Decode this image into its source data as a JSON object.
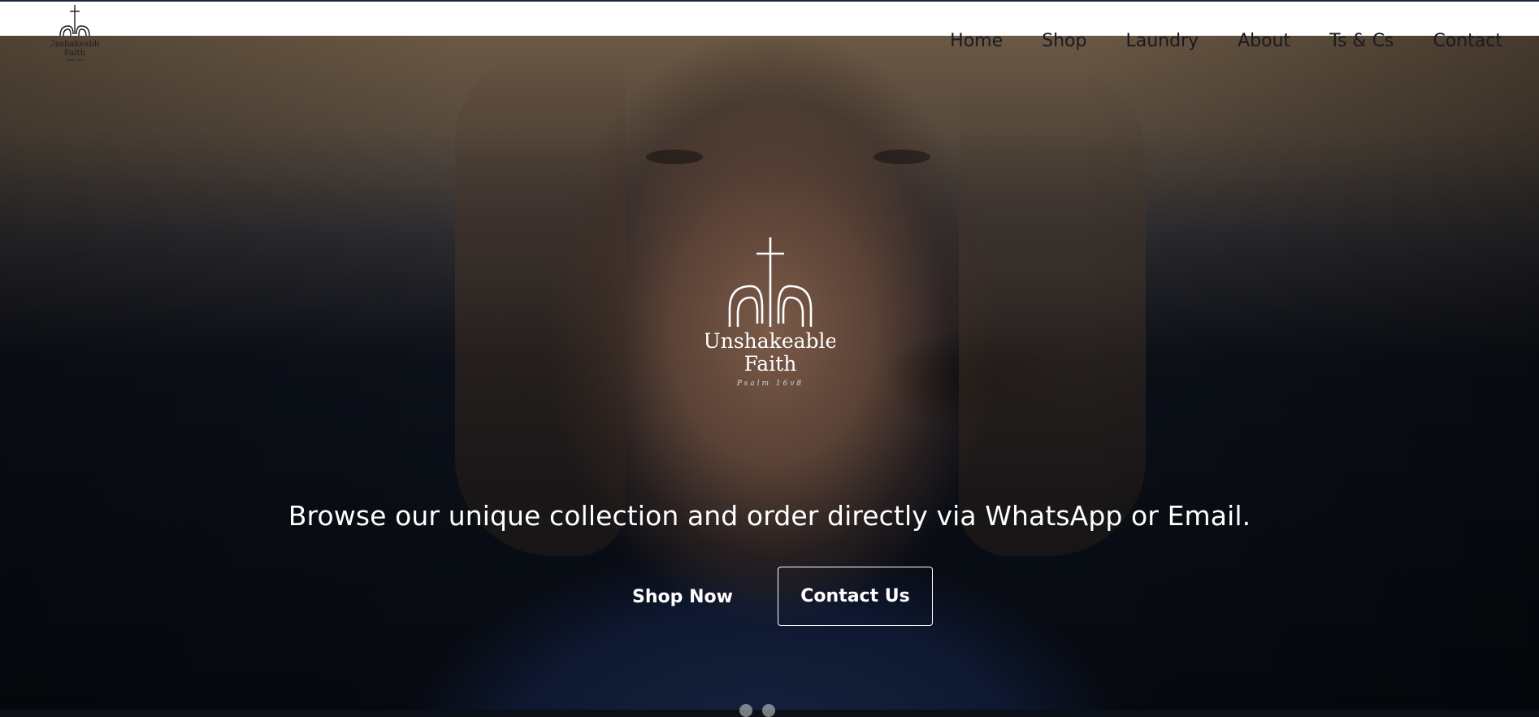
{
  "brand": {
    "name_line1": "Unshakeable",
    "name_line2": "Faith",
    "verse": "Psalm 16v8"
  },
  "nav": {
    "items": [
      {
        "label": "Home"
      },
      {
        "label": "Shop"
      },
      {
        "label": "Laundry"
      },
      {
        "label": "About"
      },
      {
        "label": "Ts & Cs"
      },
      {
        "label": "Contact"
      }
    ]
  },
  "hero": {
    "tagline": "Browse our unique collection and order directly via WhatsApp or Email.",
    "primary_button": "Shop Now",
    "secondary_button": "Contact Us",
    "slides": 2,
    "active_slide": 1
  },
  "colors": {
    "header_bg": "#ffffff",
    "nav_text": "#1a1a22",
    "hero_text": "#ffffff"
  }
}
